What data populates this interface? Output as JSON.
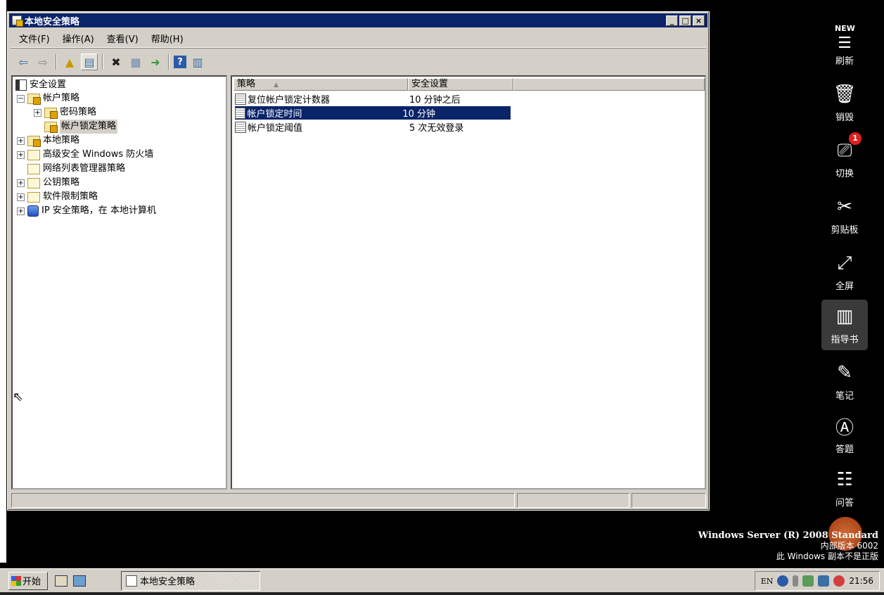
{
  "window": {
    "title": "本地安全策略",
    "controls": [
      "_",
      "□",
      "×"
    ]
  },
  "menu": [
    "文件(F)",
    "操作(A)",
    "查看(V)",
    "帮助(H)"
  ],
  "toolbar": {
    "icons": [
      "back-arrow",
      "forward-arrow",
      "up-folder",
      "show-hide-tree",
      "delete",
      "properties",
      "export-list",
      "help",
      "show-hide-action-pane"
    ]
  },
  "tree": {
    "root": "安全设置",
    "nodes": [
      {
        "label": "帐户策略",
        "expander": "⊟"
      },
      {
        "label": "密码策略",
        "expander": "⊞"
      },
      {
        "label": "帐户锁定策略",
        "expander": ""
      },
      {
        "label": "本地策略",
        "expander": "⊞"
      },
      {
        "label": "高级安全 Windows 防火墙",
        "expander": "⊞"
      },
      {
        "label": "网络列表管理器策略",
        "expander": ""
      },
      {
        "label": "公钥策略",
        "expander": "⊞"
      },
      {
        "label": "软件限制策略",
        "expander": "⊞"
      },
      {
        "label": "IP 安全策略，在 本地计算机",
        "expander": "⊞"
      }
    ]
  },
  "list": {
    "columns": [
      "策略",
      "安全设置"
    ],
    "sort_indicator": "▲",
    "rows": [
      {
        "policy": "复位帐户锁定计数器",
        "setting": "10 分钟之后"
      },
      {
        "policy": "帐户锁定时间",
        "setting": "10 分钟"
      },
      {
        "policy": "帐户锁定阈值",
        "setting": "5 次无效登录"
      }
    ],
    "selected_index": 1
  },
  "sidebar": {
    "items": [
      {
        "label": "刷新",
        "icon": "new-badge-icon"
      },
      {
        "label": "销毁",
        "icon": "trash-icon"
      },
      {
        "label": "切换",
        "icon": "switch-icon",
        "badge": "1"
      },
      {
        "label": "剪贴板",
        "icon": "scissors-icon"
      },
      {
        "label": "全屏",
        "icon": "fullscreen-icon"
      },
      {
        "label": "指导书",
        "icon": "book-icon"
      },
      {
        "label": "笔记",
        "icon": "pen-icon"
      },
      {
        "label": "答题",
        "icon": "answer-icon"
      },
      {
        "label": "问答",
        "icon": "qa-icon"
      }
    ],
    "new_badge": "NEW"
  },
  "watermark": {
    "line1": "Windows Server (R) 2008 Standard",
    "line2": "内部版本 6002",
    "line3": "此 Windows 副本不是正版"
  },
  "taskbar": {
    "start": "开始",
    "task": "本地安全策略",
    "lang": "EN",
    "clock": "21:56"
  },
  "colors": {
    "title_bar": "#0a246a",
    "selection": "#0a246a",
    "chrome": "#d4d0c8"
  }
}
